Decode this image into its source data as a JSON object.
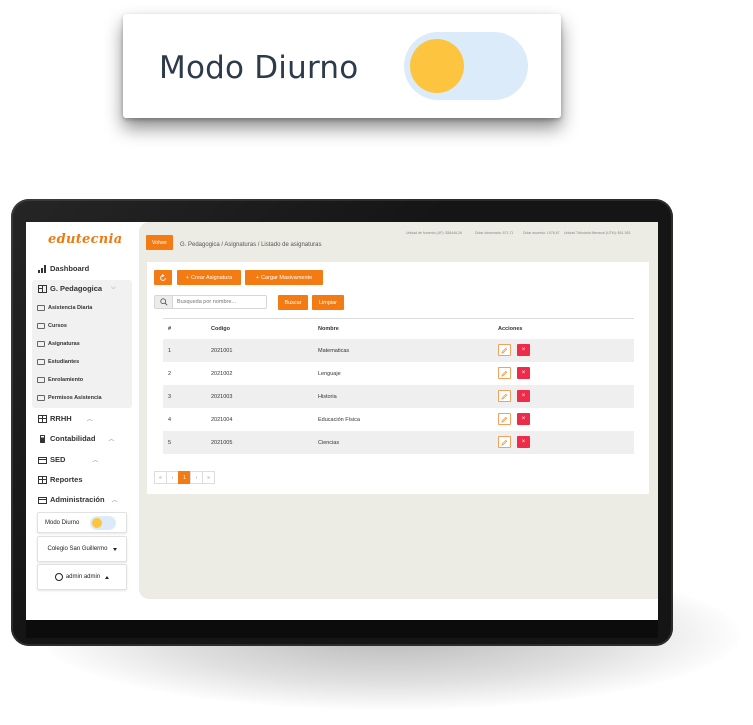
{
  "zoom": {
    "label": "Modo Diurno",
    "toggle_on": false
  },
  "brand": {
    "logo": "edutecnia",
    "accent": "#f37b13",
    "toggle_knob": "#fdc440",
    "toggle_track": "#dcebf9",
    "danger": "#ee2c4a"
  },
  "sidebar": {
    "dashboard": "Dashboard",
    "pedagogica": {
      "label": "G. Pedagogica",
      "items": [
        "Asistencia Diaria",
        "Cursos",
        "Asignaturas",
        "Estudiantes",
        "Enrolamiento",
        "Permisos Asistencia"
      ]
    },
    "rrhh": "RRHH",
    "contabilidad": "Contabilidad",
    "sed": "SED",
    "reportes": "Reportes",
    "administracion": "Administración",
    "modo": "Modo Diurno",
    "colegio": "Colegio San Guillermo",
    "user": "admin admin"
  },
  "header": {
    "volver": "Volver",
    "breadcrumb": [
      "G. Pedagogica",
      "Asignaturas",
      "Listado de asignaturas"
    ],
    "uf": "Unidad de fomento (UF): $36446,26",
    "dolar_obs": "Dólar observado: 871,71",
    "dolar_acu": "Dólar acuerdo: 1078,67",
    "utm": "Unidad Tributaria Mensual (UTM): $61.363"
  },
  "toolbar": {
    "crear": "Crear Asignatura",
    "cargar": "Cargar Masivamente",
    "search_placeholder": "Busqueda por nombre...",
    "buscar": "Buscar",
    "limpiar": "Limpiar"
  },
  "table": {
    "columns": [
      "#",
      "Codigo",
      "Nombre",
      "Acciones"
    ],
    "rows": [
      {
        "num": "1",
        "codigo": "2021001",
        "nombre": "Matematicas"
      },
      {
        "num": "2",
        "codigo": "2021002",
        "nombre": "Lenguaje"
      },
      {
        "num": "3",
        "codigo": "2021003",
        "nombre": "Historia"
      },
      {
        "num": "4",
        "codigo": "2021004",
        "nombre": "Educación Física"
      },
      {
        "num": "5",
        "codigo": "2021005",
        "nombre": "Ciencias"
      }
    ]
  },
  "pager": {
    "first": "«",
    "prev": "‹",
    "current": "1",
    "next": "›",
    "last": "»"
  }
}
